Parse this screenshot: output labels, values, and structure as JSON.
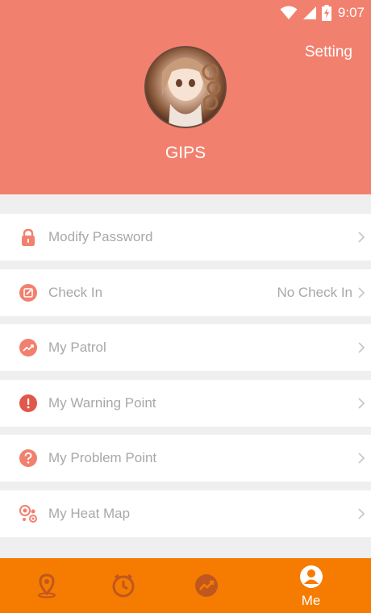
{
  "status_bar": {
    "time": "9:07",
    "icons": [
      "wifi-icon",
      "cellular-signal-icon",
      "battery-charging-icon"
    ]
  },
  "header": {
    "setting_label": "Setting",
    "username": "GIPS",
    "background_color": "#f2806e"
  },
  "menu": {
    "items": [
      {
        "label": "Modify Password",
        "value": "",
        "icon": "lock-icon"
      },
      {
        "label": "Check In",
        "value": "No Check In",
        "icon": "edit-icon"
      },
      {
        "label": "My Patrol",
        "value": "",
        "icon": "trend-icon"
      },
      {
        "label": "My Warning Point",
        "value": "",
        "icon": "exclamation-icon"
      },
      {
        "label": "My Problem Point",
        "value": "",
        "icon": "question-icon"
      },
      {
        "label": "My Heat Map",
        "value": "",
        "icon": "heat-map-icon"
      }
    ],
    "icon_color": "#f2806e",
    "text_color": "#a8a8a8"
  },
  "tabbar": {
    "background_color": "#f57c00",
    "tabs": [
      {
        "icon": "map-pin-icon",
        "label": "",
        "active": false
      },
      {
        "icon": "clock-icon",
        "label": "",
        "active": false
      },
      {
        "icon": "trend-chart-icon",
        "label": "",
        "active": false
      },
      {
        "icon": "person-icon",
        "label": "Me",
        "active": true
      }
    ]
  }
}
